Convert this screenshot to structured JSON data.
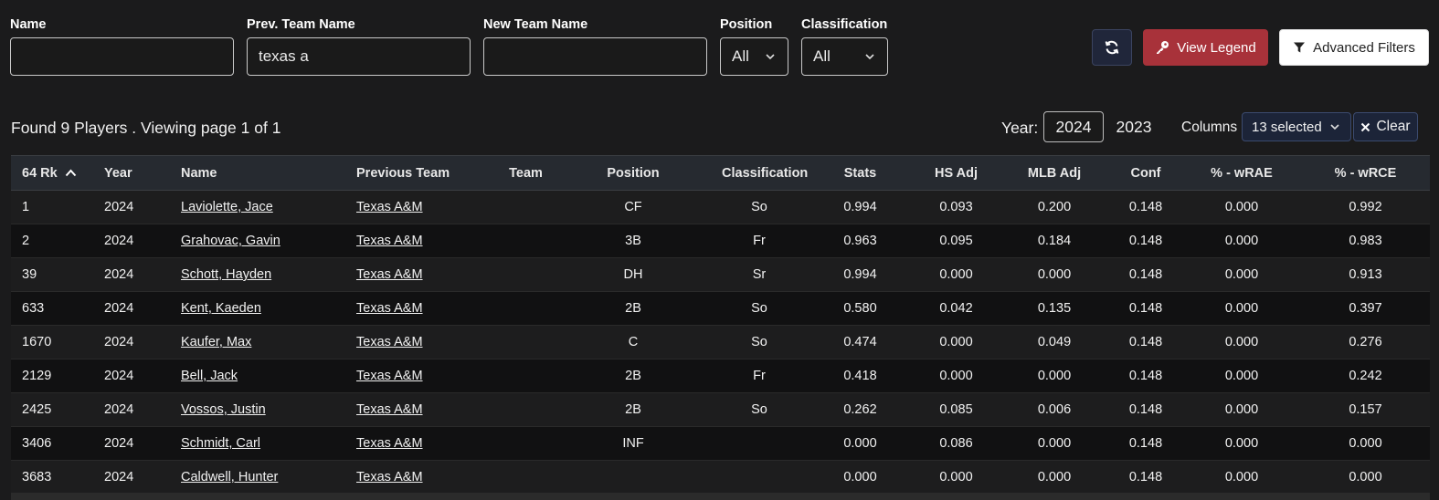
{
  "filters": {
    "name": {
      "label": "Name",
      "value": ""
    },
    "prev_team": {
      "label": "Prev. Team Name",
      "value": "texas a"
    },
    "new_team": {
      "label": "New Team Name",
      "value": ""
    },
    "position": {
      "label": "Position",
      "value": "All"
    },
    "classification": {
      "label": "Classification",
      "value": "All"
    }
  },
  "buttons": {
    "refresh_icon": "refresh-icon",
    "view_legend": "View Legend",
    "advanced_filters": "Advanced Filters"
  },
  "colors": {
    "accent_red": "#a8323a",
    "bg": "#1b1b1c"
  },
  "results": {
    "found_text": "Found 9 Players . Viewing page 1 of 1",
    "year_label": "Year:",
    "years": [
      "2024",
      "2023"
    ],
    "columns_label": "Columns",
    "columns_selected": "13 selected",
    "clear_label": "Clear"
  },
  "table": {
    "headers": [
      "64 Rk",
      "Year",
      "Name",
      "Previous Team",
      "Team",
      "Position",
      "Classification",
      "Stats",
      "HS Adj",
      "MLB Adj",
      "Conf",
      "% - wRAE",
      "% - wRCE"
    ],
    "rows": [
      [
        "1",
        "2024",
        "Laviolette, Jace",
        "Texas A&M",
        "",
        "CF",
        "So",
        "0.994",
        "0.093",
        "0.200",
        "0.148",
        "0.000",
        "0.992"
      ],
      [
        "2",
        "2024",
        "Grahovac, Gavin",
        "Texas A&M",
        "",
        "3B",
        "Fr",
        "0.963",
        "0.095",
        "0.184",
        "0.148",
        "0.000",
        "0.983"
      ],
      [
        "39",
        "2024",
        "Schott, Hayden",
        "Texas A&M",
        "",
        "DH",
        "Sr",
        "0.994",
        "0.000",
        "0.000",
        "0.148",
        "0.000",
        "0.913"
      ],
      [
        "633",
        "2024",
        "Kent, Kaeden",
        "Texas A&M",
        "",
        "2B",
        "So",
        "0.580",
        "0.042",
        "0.135",
        "0.148",
        "0.000",
        "0.397"
      ],
      [
        "1670",
        "2024",
        "Kaufer, Max",
        "Texas A&M",
        "",
        "C",
        "So",
        "0.474",
        "0.000",
        "0.049",
        "0.148",
        "0.000",
        "0.276"
      ],
      [
        "2129",
        "2024",
        "Bell, Jack",
        "Texas A&M",
        "",
        "2B",
        "Fr",
        "0.418",
        "0.000",
        "0.000",
        "0.148",
        "0.000",
        "0.242"
      ],
      [
        "2425",
        "2024",
        "Vossos, Justin",
        "Texas A&M",
        "",
        "2B",
        "So",
        "0.262",
        "0.085",
        "0.006",
        "0.148",
        "0.000",
        "0.157"
      ],
      [
        "3406",
        "2024",
        "Schmidt, Carl",
        "Texas A&M",
        "",
        "INF",
        "",
        "0.000",
        "0.086",
        "0.000",
        "0.148",
        "0.000",
        "0.000"
      ],
      [
        "3683",
        "2024",
        "Caldwell, Hunter",
        "Texas A&M",
        "",
        "",
        "",
        "0.000",
        "0.000",
        "0.000",
        "0.148",
        "0.000",
        "0.000"
      ]
    ]
  }
}
